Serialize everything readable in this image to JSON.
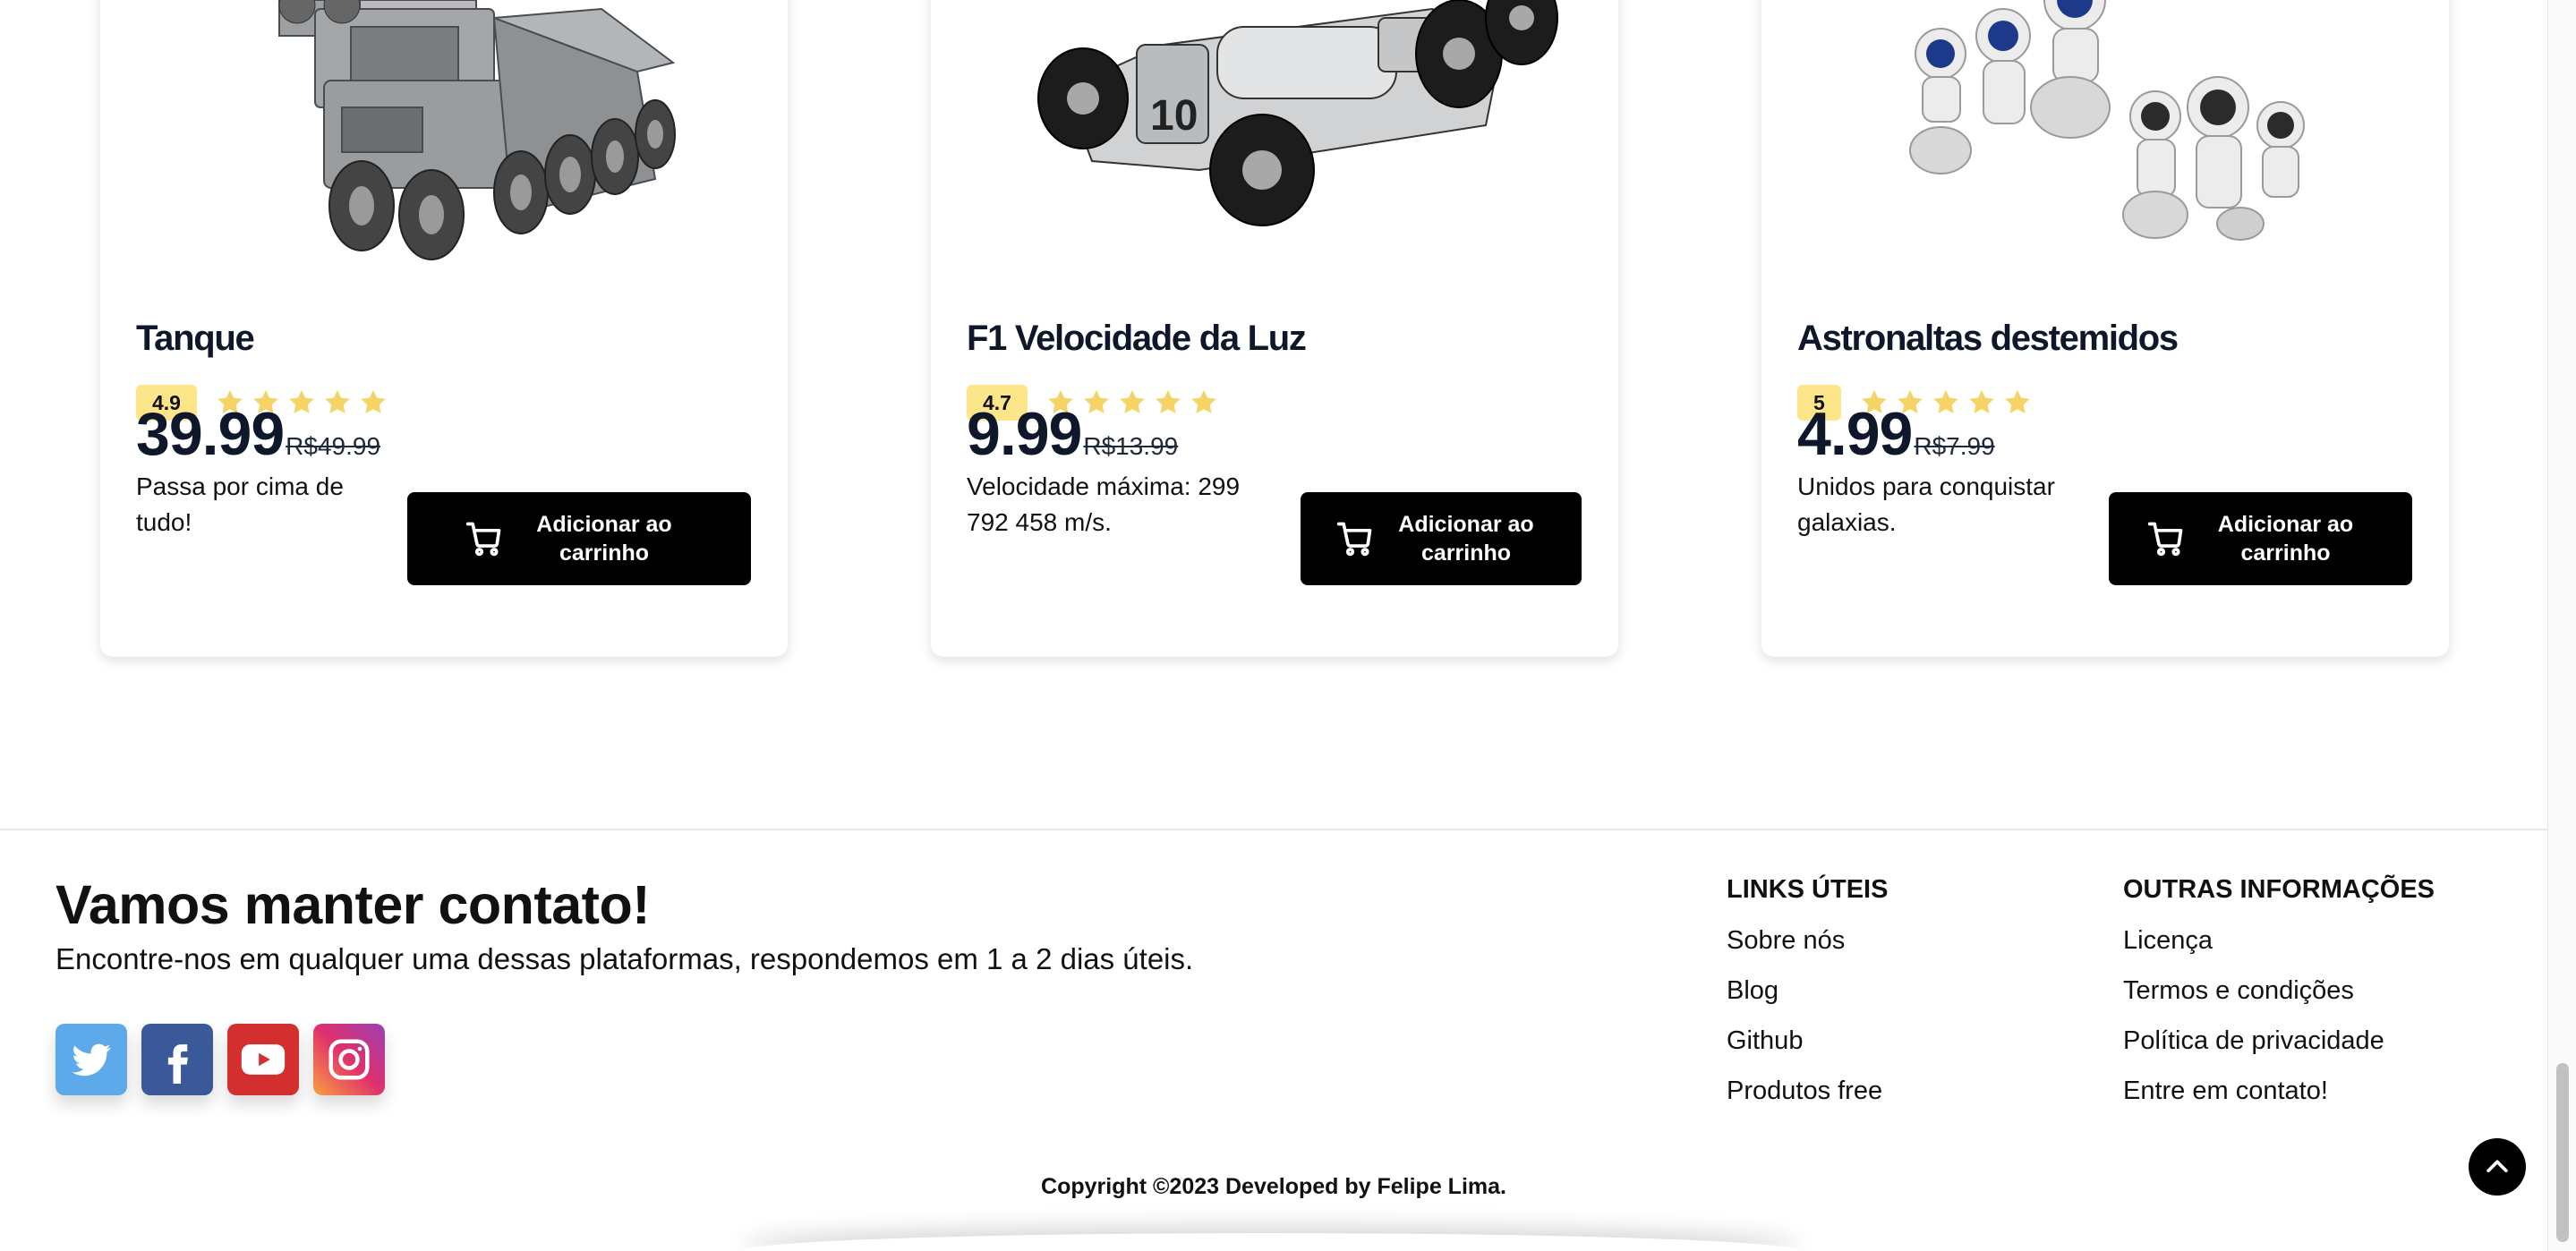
{
  "products": [
    {
      "title": "Tanque",
      "rating": "4.9",
      "price": "39.99",
      "old_price": "R$49.99",
      "description": "Passa por cima de tudo!",
      "button_label": "Adicionar ao carrinho",
      "image_icon": "tank-toy-image"
    },
    {
      "title": "F1 Velocidade da Luz",
      "rating": "4.7",
      "price": "9.99",
      "old_price": "R$13.99",
      "description": "Velocidade máxima: 299 792 458 m/s.",
      "button_label": "Adicionar ao carrinho",
      "image_icon": "race-car-toy-image"
    },
    {
      "title": "Astronaltas destemidos",
      "rating": "5",
      "price": "4.99",
      "old_price": "R$7.99",
      "description": "Unidos para conquistar galaxias.",
      "button_label": "Adicionar ao carrinho",
      "image_icon": "astronaut-figures-image"
    }
  ],
  "footer": {
    "title": "Vamos manter contato!",
    "subtitle": "Encontre-nos em qualquer uma dessas plataformas, respondemos em 1 a 2 dias úteis.",
    "socials": [
      {
        "name": "twitter",
        "icon": "twitter-icon",
        "color": "#5da9e9"
      },
      {
        "name": "facebook",
        "icon": "facebook-icon",
        "color": "#3b5998"
      },
      {
        "name": "youtube",
        "icon": "youtube-icon",
        "color": "#d32f2f"
      },
      {
        "name": "instagram",
        "icon": "instagram-icon",
        "color": "#e1306c"
      }
    ],
    "useful_links": {
      "title": "LINKS ÚTEIS",
      "items": [
        "Sobre nós",
        "Blog",
        "Github",
        "Produtos free"
      ]
    },
    "other_info": {
      "title": "OUTRAS INFORMAÇÕES",
      "items": [
        "Licença",
        "Termos e condições",
        "Política de privacidade",
        "Entre em contato!"
      ]
    },
    "copyright": "Copyright ©2023 Developed by Felipe Lima."
  },
  "colors": {
    "rating_badge": "#fde68a",
    "star": "#f6d365",
    "button": "#000000"
  },
  "back_to_top_icon": "chevron-up-icon"
}
